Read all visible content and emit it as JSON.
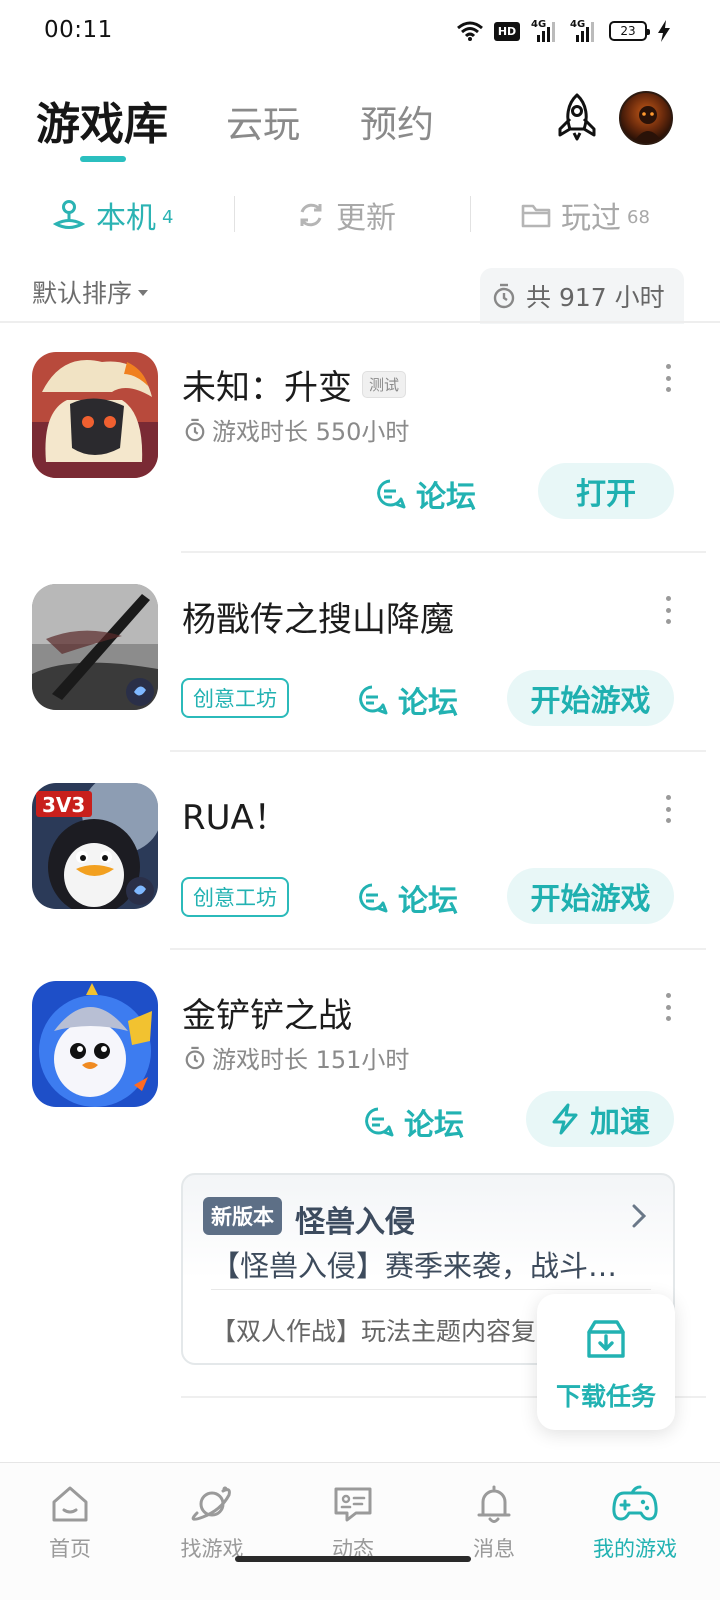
{
  "status_bar": {
    "time": "00:11",
    "icons": [
      "wifi-icon",
      "hd-icon",
      "signal-4g-icon",
      "signal-4g-icon",
      "battery-icon",
      "charging-icon"
    ],
    "hd_label": "HD",
    "net1": "4G",
    "net2": "4G",
    "battery_level": "23"
  },
  "top_tabs": [
    {
      "label": "游戏库",
      "active": true
    },
    {
      "label": "云玩",
      "active": false
    },
    {
      "label": "预约",
      "active": false
    }
  ],
  "header_icons": [
    "rocket-icon",
    "user-avatar"
  ],
  "sub_tabs": [
    {
      "label": "本机",
      "count": "4",
      "icon": "local-device-icon",
      "active": true
    },
    {
      "label": "更新",
      "count": "",
      "icon": "refresh-icon",
      "active": false
    },
    {
      "label": "玩过",
      "count": "68",
      "icon": "folder-icon",
      "active": false
    }
  ],
  "sort": {
    "label": "默认排序",
    "total_playtime": "共 917 小时"
  },
  "games": [
    {
      "title": "未知：升变",
      "tag": "测试",
      "playtime": "游戏时长 550小时",
      "forum_label": "论坛",
      "action_label": "打开"
    },
    {
      "title": "杨戬传之搜山降魔",
      "workshop_label": "创意工坊",
      "forum_label": "论坛",
      "action_label": "开始游戏"
    },
    {
      "title": "RUA！",
      "workshop_label": "创意工坊",
      "forum_label": "论坛",
      "action_label": "开始游戏"
    },
    {
      "title": "金铲铲之战",
      "playtime": "游戏时长 151小时",
      "forum_label": "论坛",
      "action_label": "加速",
      "news": {
        "badge": "新版本",
        "title": "怪兽入侵",
        "line1": "【怪兽入侵】赛季来袭，战斗…",
        "line2": "【双人作战】玩法主题内容复"
      }
    }
  ],
  "download_fab": {
    "label": "下载任务"
  },
  "bottom_nav": [
    {
      "label": "首页",
      "icon": "home-icon",
      "active": false
    },
    {
      "label": "找游戏",
      "icon": "planet-icon",
      "active": false
    },
    {
      "label": "动态",
      "icon": "message-card-icon",
      "active": false
    },
    {
      "label": "消息",
      "icon": "bell-icon",
      "active": false
    },
    {
      "label": "我的游戏",
      "icon": "gamepad-icon",
      "active": true
    }
  ],
  "colors": {
    "accent": "#22b2b2",
    "accent_light": "#e8f7f7",
    "text_primary": "#1c1c1c",
    "text_secondary": "#8a8a8a"
  }
}
